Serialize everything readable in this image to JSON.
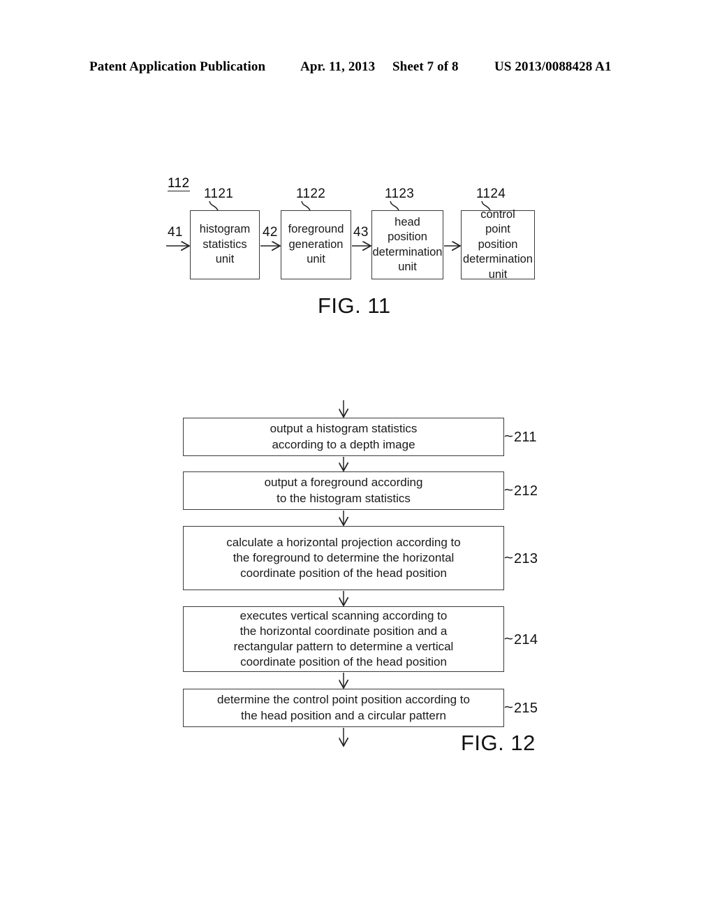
{
  "header": {
    "publication": "Patent Application Publication",
    "date": "Apr. 11, 2013",
    "sheet": "Sheet 7 of 8",
    "patent_number": "US 2013/0088428 A1"
  },
  "fig11": {
    "caption": "FIG. 11",
    "group_ref": "112",
    "blocks": [
      {
        "ref": "1121",
        "label": "histogram\nstatistics\nunit"
      },
      {
        "ref": "1122",
        "label": "foreground\ngeneration\nunit"
      },
      {
        "ref": "1123",
        "label": "head\nposition\ndetermination\nunit"
      },
      {
        "ref": "1124",
        "label": "control\npoint\nposition\ndetermination\nunit"
      }
    ],
    "signals": [
      {
        "ref": "41"
      },
      {
        "ref": "42"
      },
      {
        "ref": "43"
      }
    ]
  },
  "fig12": {
    "caption": "FIG. 12",
    "steps": [
      {
        "ref": "211",
        "text": "output a histogram statistics\naccording to a depth image"
      },
      {
        "ref": "212",
        "text": "output a foreground according\nto the histogram statistics"
      },
      {
        "ref": "213",
        "text": "calculate a horizontal projection according to\nthe foreground to determine the horizontal\ncoordinate position of the head position"
      },
      {
        "ref": "214",
        "text": "executes vertical scanning according to\nthe horizontal coordinate position and a\nrectangular pattern to determine a vertical\ncoordinate position of the head position"
      },
      {
        "ref": "215",
        "text": "determine the control point position according to\nthe head position and a circular pattern"
      }
    ]
  },
  "colors": {
    "ink": "#1a1a1a",
    "box_border": "#3b3b3b",
    "page_background": "#ffffff"
  }
}
